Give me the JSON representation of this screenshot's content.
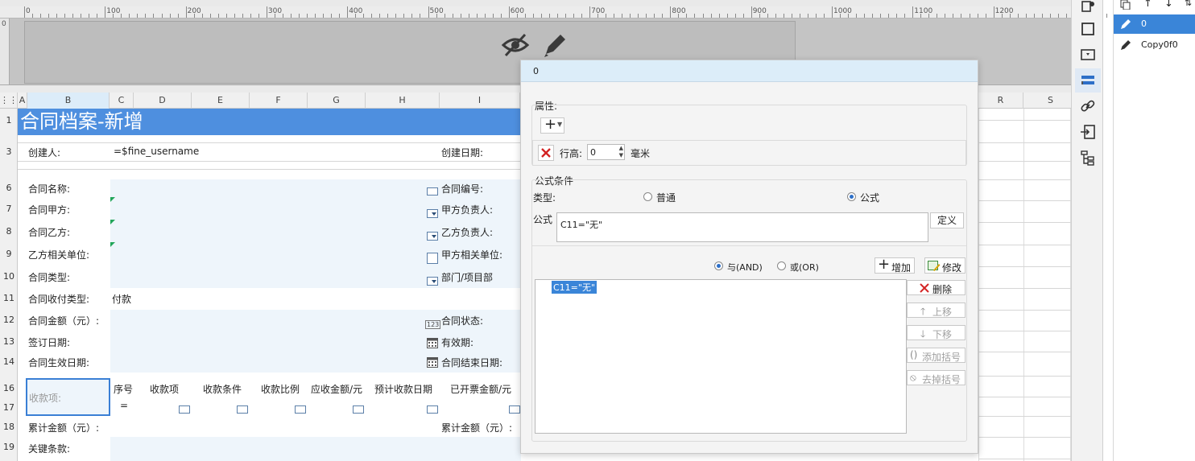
{
  "ruler": {
    "labels": [
      "0",
      "100",
      "200",
      "300",
      "400",
      "500",
      "600",
      "700",
      "800",
      "900",
      "1000",
      "1100",
      "1200"
    ],
    "vlabel": "0"
  },
  "columns": [
    "A",
    "B",
    "C",
    "D",
    "E",
    "F",
    "G",
    "H",
    "I",
    "R",
    "S"
  ],
  "rows": [
    "1",
    "3",
    "6",
    "7",
    "8",
    "9",
    "10",
    "11",
    "12",
    "13",
    "14",
    "16",
    "17",
    "18",
    "19"
  ],
  "sheet": {
    "title": "合同档案-新增",
    "creator_label": "创建人:",
    "creator_value": "=$fine_username",
    "create_date_label": "创建日期:",
    "fields_left": [
      "合同名称:",
      "合同甲方:",
      "合同乙方:",
      "乙方相关单位:",
      "合同类型:",
      "合同收付类型:",
      "合同金额（元）:",
      "签订日期:",
      "合同生效日期:"
    ],
    "fields_right": [
      "合同编号:",
      "甲方负责人:",
      "乙方负责人:",
      "甲方相关单位:",
      "部门/项目部",
      "合同状态:",
      "有效期:",
      "合同结束日期:"
    ],
    "payment_type_value": "付款",
    "receipt_label": "收款项:",
    "receipt_headers": [
      "序号",
      "收款项",
      "收款条件",
      "收款比例",
      "应收金额/元",
      "预计收款日期",
      "已开票金额/元"
    ],
    "row17_value": "=",
    "total_left": "累计金额（元）:",
    "total_right": "累计金额（元）:",
    "key_terms": "关键条款:",
    "num_icon": "123"
  },
  "dialog": {
    "title": "0",
    "attr_section": "属性:",
    "row_height_label": "行高:",
    "row_height_value": "0",
    "unit": "毫米",
    "formula_section": "公式条件",
    "type_label": "类型:",
    "type_normal": "普通",
    "type_formula": "公式",
    "formula_label": "公式",
    "formula_value": "C11=\"无\"",
    "define_button": "定义",
    "and_label": "与(AND)",
    "or_label": "或(OR)",
    "add_button": "增加",
    "modify_button": "修改",
    "conditions": [
      "C11=\"无\""
    ],
    "delete_button": "删除",
    "up_button": "上移",
    "down_button": "下移",
    "add_paren_button": "添加括号",
    "remove_paren_button": "去掉括号"
  },
  "right_panel": {
    "items": [
      "0",
      "Copy0f0"
    ]
  },
  "colors": {
    "title_band": "#4e8fdf",
    "dialog_title": "#dcedf9",
    "selected": "#3a7fd5",
    "panel_selected": "#3a85d8"
  }
}
